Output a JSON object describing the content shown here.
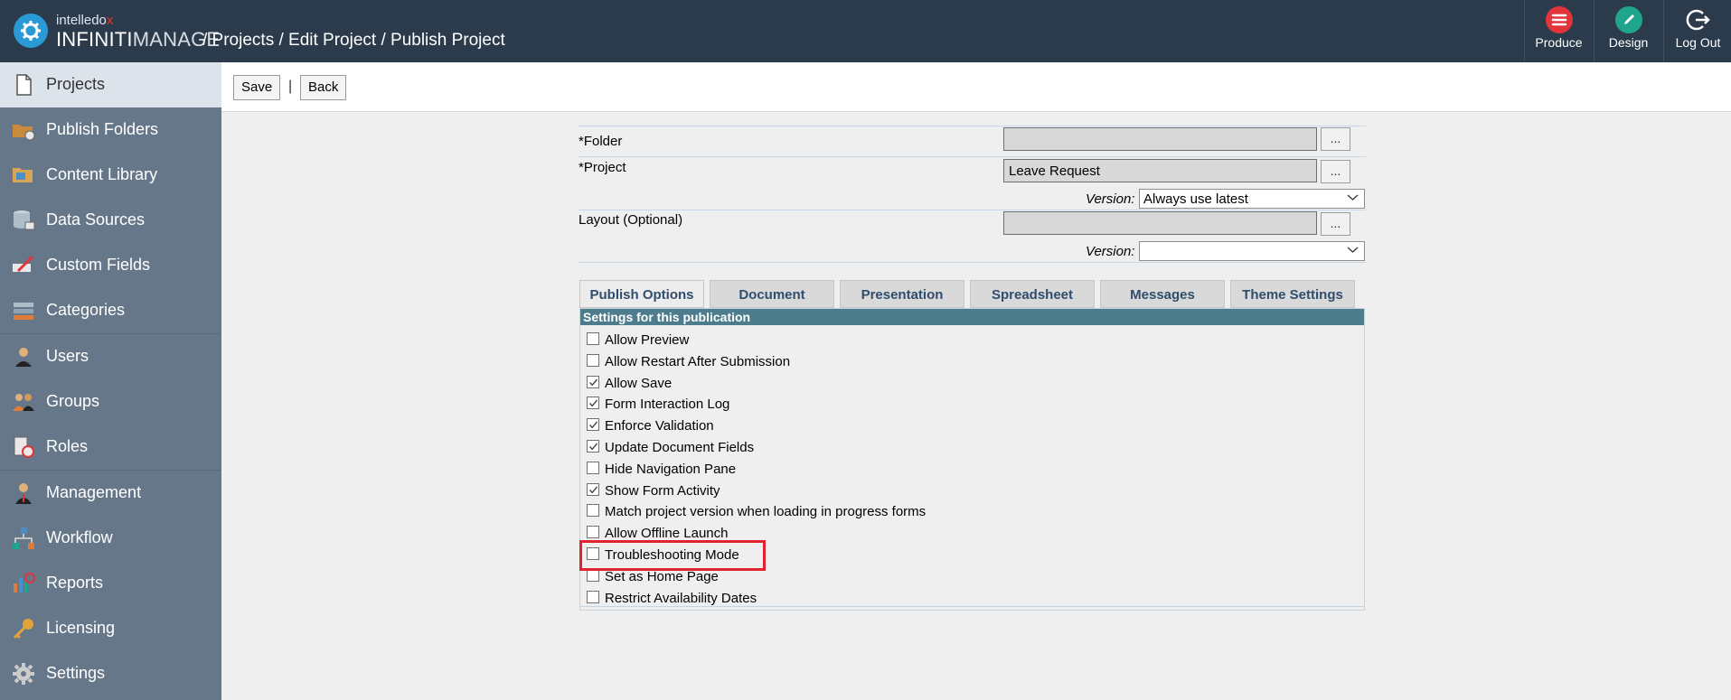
{
  "header": {
    "brand_top": "intelledo",
    "brand_top_x": "x",
    "brand_main": "INFINITI",
    "brand_manage": "MANAGE",
    "breadcrumb": "/ Projects / Edit Project / Publish Project",
    "actions": [
      {
        "label": "Produce",
        "icon": "produce-icon",
        "color": "#e2343b"
      },
      {
        "label": "Design",
        "icon": "pencil-icon",
        "color": "#1fa58c"
      },
      {
        "label": "Log Out",
        "icon": "logout-icon",
        "color": "#2b3b4c"
      }
    ]
  },
  "sidebar": {
    "items": [
      {
        "label": "Projects",
        "icon": "document-icon"
      },
      {
        "label": "Publish Folders",
        "icon": "publish-folder-icon"
      },
      {
        "label": "Content Library",
        "icon": "content-library-icon"
      },
      {
        "label": "Data Sources",
        "icon": "database-icon"
      },
      {
        "label": "Custom Fields",
        "icon": "custom-fields-icon"
      },
      {
        "label": "Categories",
        "icon": "categories-icon"
      },
      {
        "label": "Users",
        "icon": "user-icon"
      },
      {
        "label": "Groups",
        "icon": "groups-icon"
      },
      {
        "label": "Roles",
        "icon": "roles-icon"
      },
      {
        "label": "Management",
        "icon": "management-icon"
      },
      {
        "label": "Workflow",
        "icon": "workflow-icon"
      },
      {
        "label": "Reports",
        "icon": "reports-icon"
      },
      {
        "label": "Licensing",
        "icon": "key-icon"
      },
      {
        "label": "Settings",
        "icon": "gear-icon"
      }
    ],
    "active": "Projects"
  },
  "toolbar": {
    "save_label": "Save",
    "separator": "|",
    "back_label": "Back"
  },
  "form": {
    "folder_label": "*Folder",
    "folder_value": "",
    "project_label": "*Project",
    "project_value": "Leave Request",
    "version_label": "Version:",
    "project_version": "Always use latest",
    "layout_label": "Layout (Optional)",
    "layout_value": "",
    "layout_version": "",
    "browse_label": "..."
  },
  "tabs": [
    "Publish Options",
    "Document",
    "Presentation",
    "Spreadsheet",
    "Messages",
    "Theme Settings"
  ],
  "active_tab": "Publish Options",
  "settings": {
    "header": "Settings for this publication",
    "options": [
      {
        "label": "Allow Preview",
        "checked": false
      },
      {
        "label": "Allow Restart After Submission",
        "checked": false
      },
      {
        "label": "Allow Save",
        "checked": true
      },
      {
        "label": "Form Interaction Log",
        "checked": true
      },
      {
        "label": "Enforce Validation",
        "checked": true
      },
      {
        "label": "Update Document Fields",
        "checked": true
      },
      {
        "label": "Hide Navigation Pane",
        "checked": false
      },
      {
        "label": "Show Form Activity",
        "checked": true
      },
      {
        "label": "Match project version when loading in progress forms",
        "checked": false
      },
      {
        "label": "Allow Offline Launch",
        "checked": false
      },
      {
        "label": "Troubleshooting Mode",
        "checked": false
      },
      {
        "label": "Set as Home Page",
        "checked": false
      },
      {
        "label": "Restrict Availability Dates",
        "checked": false
      }
    ]
  },
  "highlight_color": "#e0242f"
}
